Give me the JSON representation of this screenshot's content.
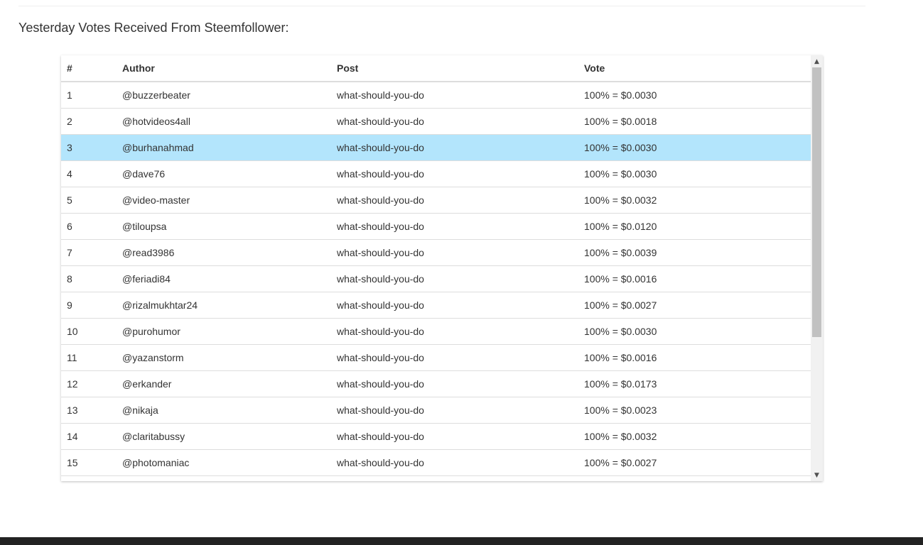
{
  "section": {
    "title": "Yesterday Votes Received From Steemfollower:"
  },
  "table": {
    "headers": [
      "#",
      "Author",
      "Post",
      "Vote"
    ],
    "highlighted_row": 3,
    "rows": [
      {
        "num": "1",
        "author": "@buzzerbeater",
        "post": "what-should-you-do",
        "vote": "100% = $0.0030"
      },
      {
        "num": "2",
        "author": "@hotvideos4all",
        "post": "what-should-you-do",
        "vote": "100% = $0.0018"
      },
      {
        "num": "3",
        "author": "@burhanahmad",
        "post": "what-should-you-do",
        "vote": "100% = $0.0030"
      },
      {
        "num": "4",
        "author": "@dave76",
        "post": "what-should-you-do",
        "vote": "100% = $0.0030"
      },
      {
        "num": "5",
        "author": "@video-master",
        "post": "what-should-you-do",
        "vote": "100% = $0.0032"
      },
      {
        "num": "6",
        "author": "@tiloupsa",
        "post": "what-should-you-do",
        "vote": "100% = $0.0120"
      },
      {
        "num": "7",
        "author": "@read3986",
        "post": "what-should-you-do",
        "vote": "100% = $0.0039"
      },
      {
        "num": "8",
        "author": "@feriadi84",
        "post": "what-should-you-do",
        "vote": "100% = $0.0016"
      },
      {
        "num": "9",
        "author": "@rizalmukhtar24",
        "post": "what-should-you-do",
        "vote": "100% = $0.0027"
      },
      {
        "num": "10",
        "author": "@purohumor",
        "post": "what-should-you-do",
        "vote": "100% = $0.0030"
      },
      {
        "num": "11",
        "author": "@yazanstorm",
        "post": "what-should-you-do",
        "vote": "100% = $0.0016"
      },
      {
        "num": "12",
        "author": "@erkander",
        "post": "what-should-you-do",
        "vote": "100% = $0.0173"
      },
      {
        "num": "13",
        "author": "@nikaja",
        "post": "what-should-you-do",
        "vote": "100% = $0.0023"
      },
      {
        "num": "14",
        "author": "@claritabussy",
        "post": "what-should-you-do",
        "vote": "100% = $0.0032"
      },
      {
        "num": "15",
        "author": "@photomaniac",
        "post": "what-should-you-do",
        "vote": "100% = $0.0027"
      }
    ]
  },
  "icons": {
    "scroll_up": "chevron-up-icon",
    "scroll_down": "chevron-down-icon"
  },
  "colors": {
    "highlight": "#b3e5fc",
    "footer": "#222222"
  }
}
